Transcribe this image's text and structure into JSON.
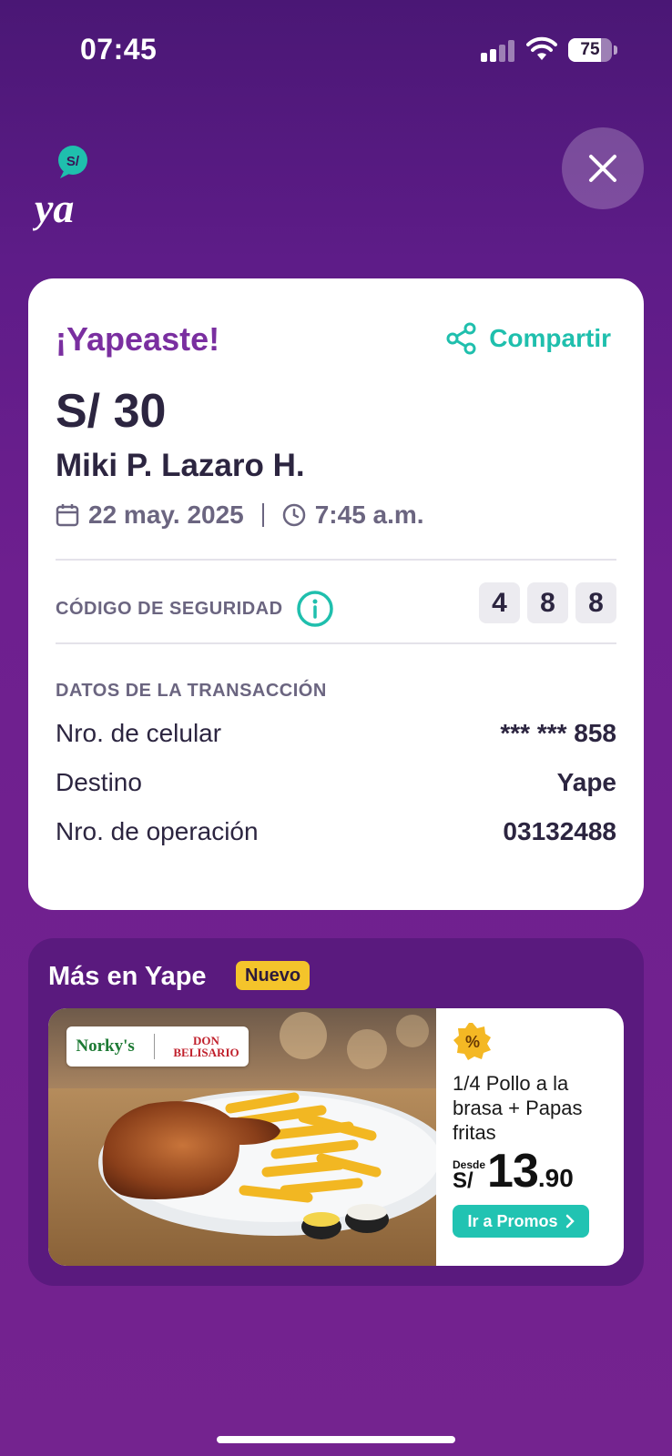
{
  "status_bar": {
    "time": "07:45",
    "battery_level": "75",
    "icons": [
      "cellular-signal-icon",
      "wifi-icon",
      "battery-icon"
    ]
  },
  "header": {
    "logo_badge": "S/",
    "logo_text": "ya",
    "close_icon": "close-icon"
  },
  "receipt": {
    "title": "¡Yapeaste!",
    "share_label": "Compartir",
    "amount": "S/ 30",
    "recipient": "Miki P. Lazaro H.",
    "date": "22 may. 2025",
    "time": "7:45 a.m.",
    "security_code_label": "CÓDIGO DE SEGURIDAD",
    "security_code": [
      "4",
      "8",
      "8"
    ],
    "transaction_heading": "DATOS DE LA TRANSACCIÓN",
    "rows": [
      {
        "label": "Nro. de celular",
        "value": "*** *** 858"
      },
      {
        "label": "Destino",
        "value": "Yape"
      },
      {
        "label": "Nro. de operación",
        "value": "03132488"
      }
    ]
  },
  "promo": {
    "section_title": "Más en Yape",
    "badge": "Nuevo",
    "brand_1": "Norky's",
    "brand_2_top": "DON",
    "brand_2_bottom": "BELISARIO",
    "tag_symbol": "%",
    "name": "1/4 Pollo a la brasa + Papas fritas",
    "price_prefix": "Desde",
    "price_currency": "S/",
    "price_integer": "13",
    "price_decimal": ".90",
    "cta": "Ir a Promos"
  },
  "colors": {
    "background": "#6e1f8f",
    "brand_purple": "#7a2fa0",
    "accent_teal": "#1fbfad",
    "badge_yellow": "#f4c42b"
  }
}
